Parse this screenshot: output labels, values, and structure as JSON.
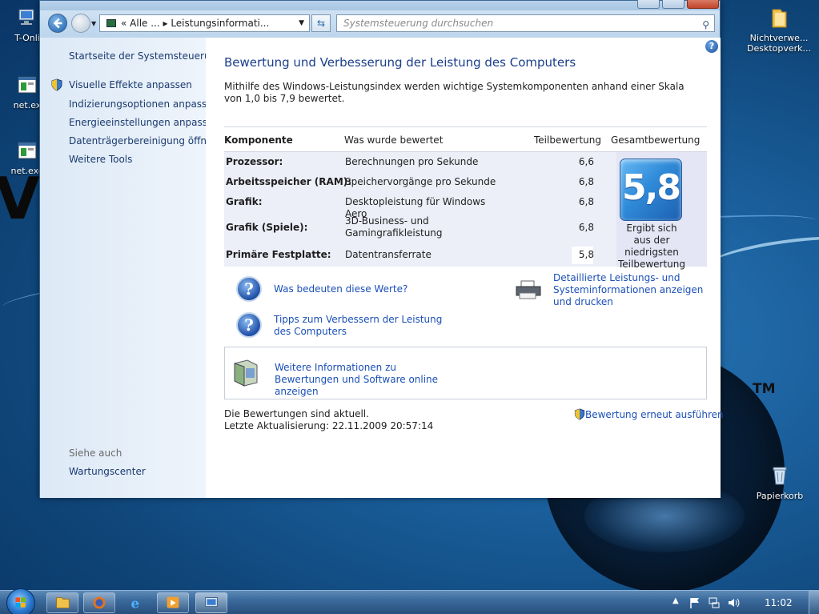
{
  "desktop": {
    "icons": [
      {
        "label": "T-Onli"
      },
      {
        "label": "net.ex"
      },
      {
        "label": "net.exe"
      },
      {
        "label": "Nichtverwe... Desktopverk..."
      },
      {
        "label": "Papierkorb"
      }
    ],
    "tm": "TM"
  },
  "window": {
    "address_path": "« Alle ... ▸ Leistungsinformati...",
    "search_placeholder": "Systemsteuerung durchsuchen"
  },
  "sidebar": {
    "items": [
      {
        "label": "Startseite der Systemsteuerung"
      },
      {
        "label": "Visuelle Effekte anpassen"
      },
      {
        "label": "Indizierungsoptionen anpassen"
      },
      {
        "label": "Energieeinstellungen anpassen"
      },
      {
        "label": "Datenträgerbereinigung öffnen"
      },
      {
        "label": "Weitere Tools"
      }
    ],
    "see_also_title": "Siehe auch",
    "see_also_items": [
      {
        "label": "Wartungscenter"
      }
    ]
  },
  "main": {
    "title": "Bewertung und Verbesserung der Leistung des Computers",
    "intro": "Mithilfe des Windows-Leistungsindex werden wichtige Systemkomponenten anhand einer Skala von 1,0 bis 7,9 bewertet.",
    "table": {
      "headers": [
        "Komponente",
        "Was wurde bewertet",
        "Teilbewertung",
        "Gesamtbewertung"
      ],
      "rows": [
        {
          "component": "Prozessor:",
          "description": "Berechnungen pro Sekunde",
          "score": "6,6"
        },
        {
          "component": "Arbeitsspeicher (RAM):",
          "description": "Speichervorgänge pro Sekunde",
          "score": "6,8"
        },
        {
          "component": "Grafik:",
          "description": "Desktopleistung für Windows Aero",
          "score": "6,8"
        },
        {
          "component": "Grafik (Spiele):",
          "description": "3D-Business- und Gamingrafikleistung",
          "score": "6,8"
        },
        {
          "component": "Primäre Festplatte:",
          "description": "Datentransferrate",
          "score": "5,8"
        }
      ],
      "base_score": "5,8",
      "base_score_note": "Ergibt sich aus der niedrigsten Teilbewertung"
    },
    "links": {
      "what_values_mean": "Was bedeuten diese Werte?",
      "tips": "Tipps zum Verbessern der Leistung des Computers",
      "detailed": "Detaillierte Leistungs- und Systeminformationen anzeigen und drucken",
      "more_info": "Weitere Informationen zu Bewertungen und Software online anzeigen"
    },
    "status": {
      "line1": "Die Bewertungen sind aktuell.",
      "line2": "Letzte Aktualisierung: 22.11.2009 20:57:14"
    },
    "rerun": "Bewertung erneut ausführen"
  },
  "taskbar": {
    "clock": "11:02"
  },
  "colors": {
    "link": "#1a4fb8",
    "title": "#1a3e8c",
    "badge": "#2f8ad8"
  }
}
